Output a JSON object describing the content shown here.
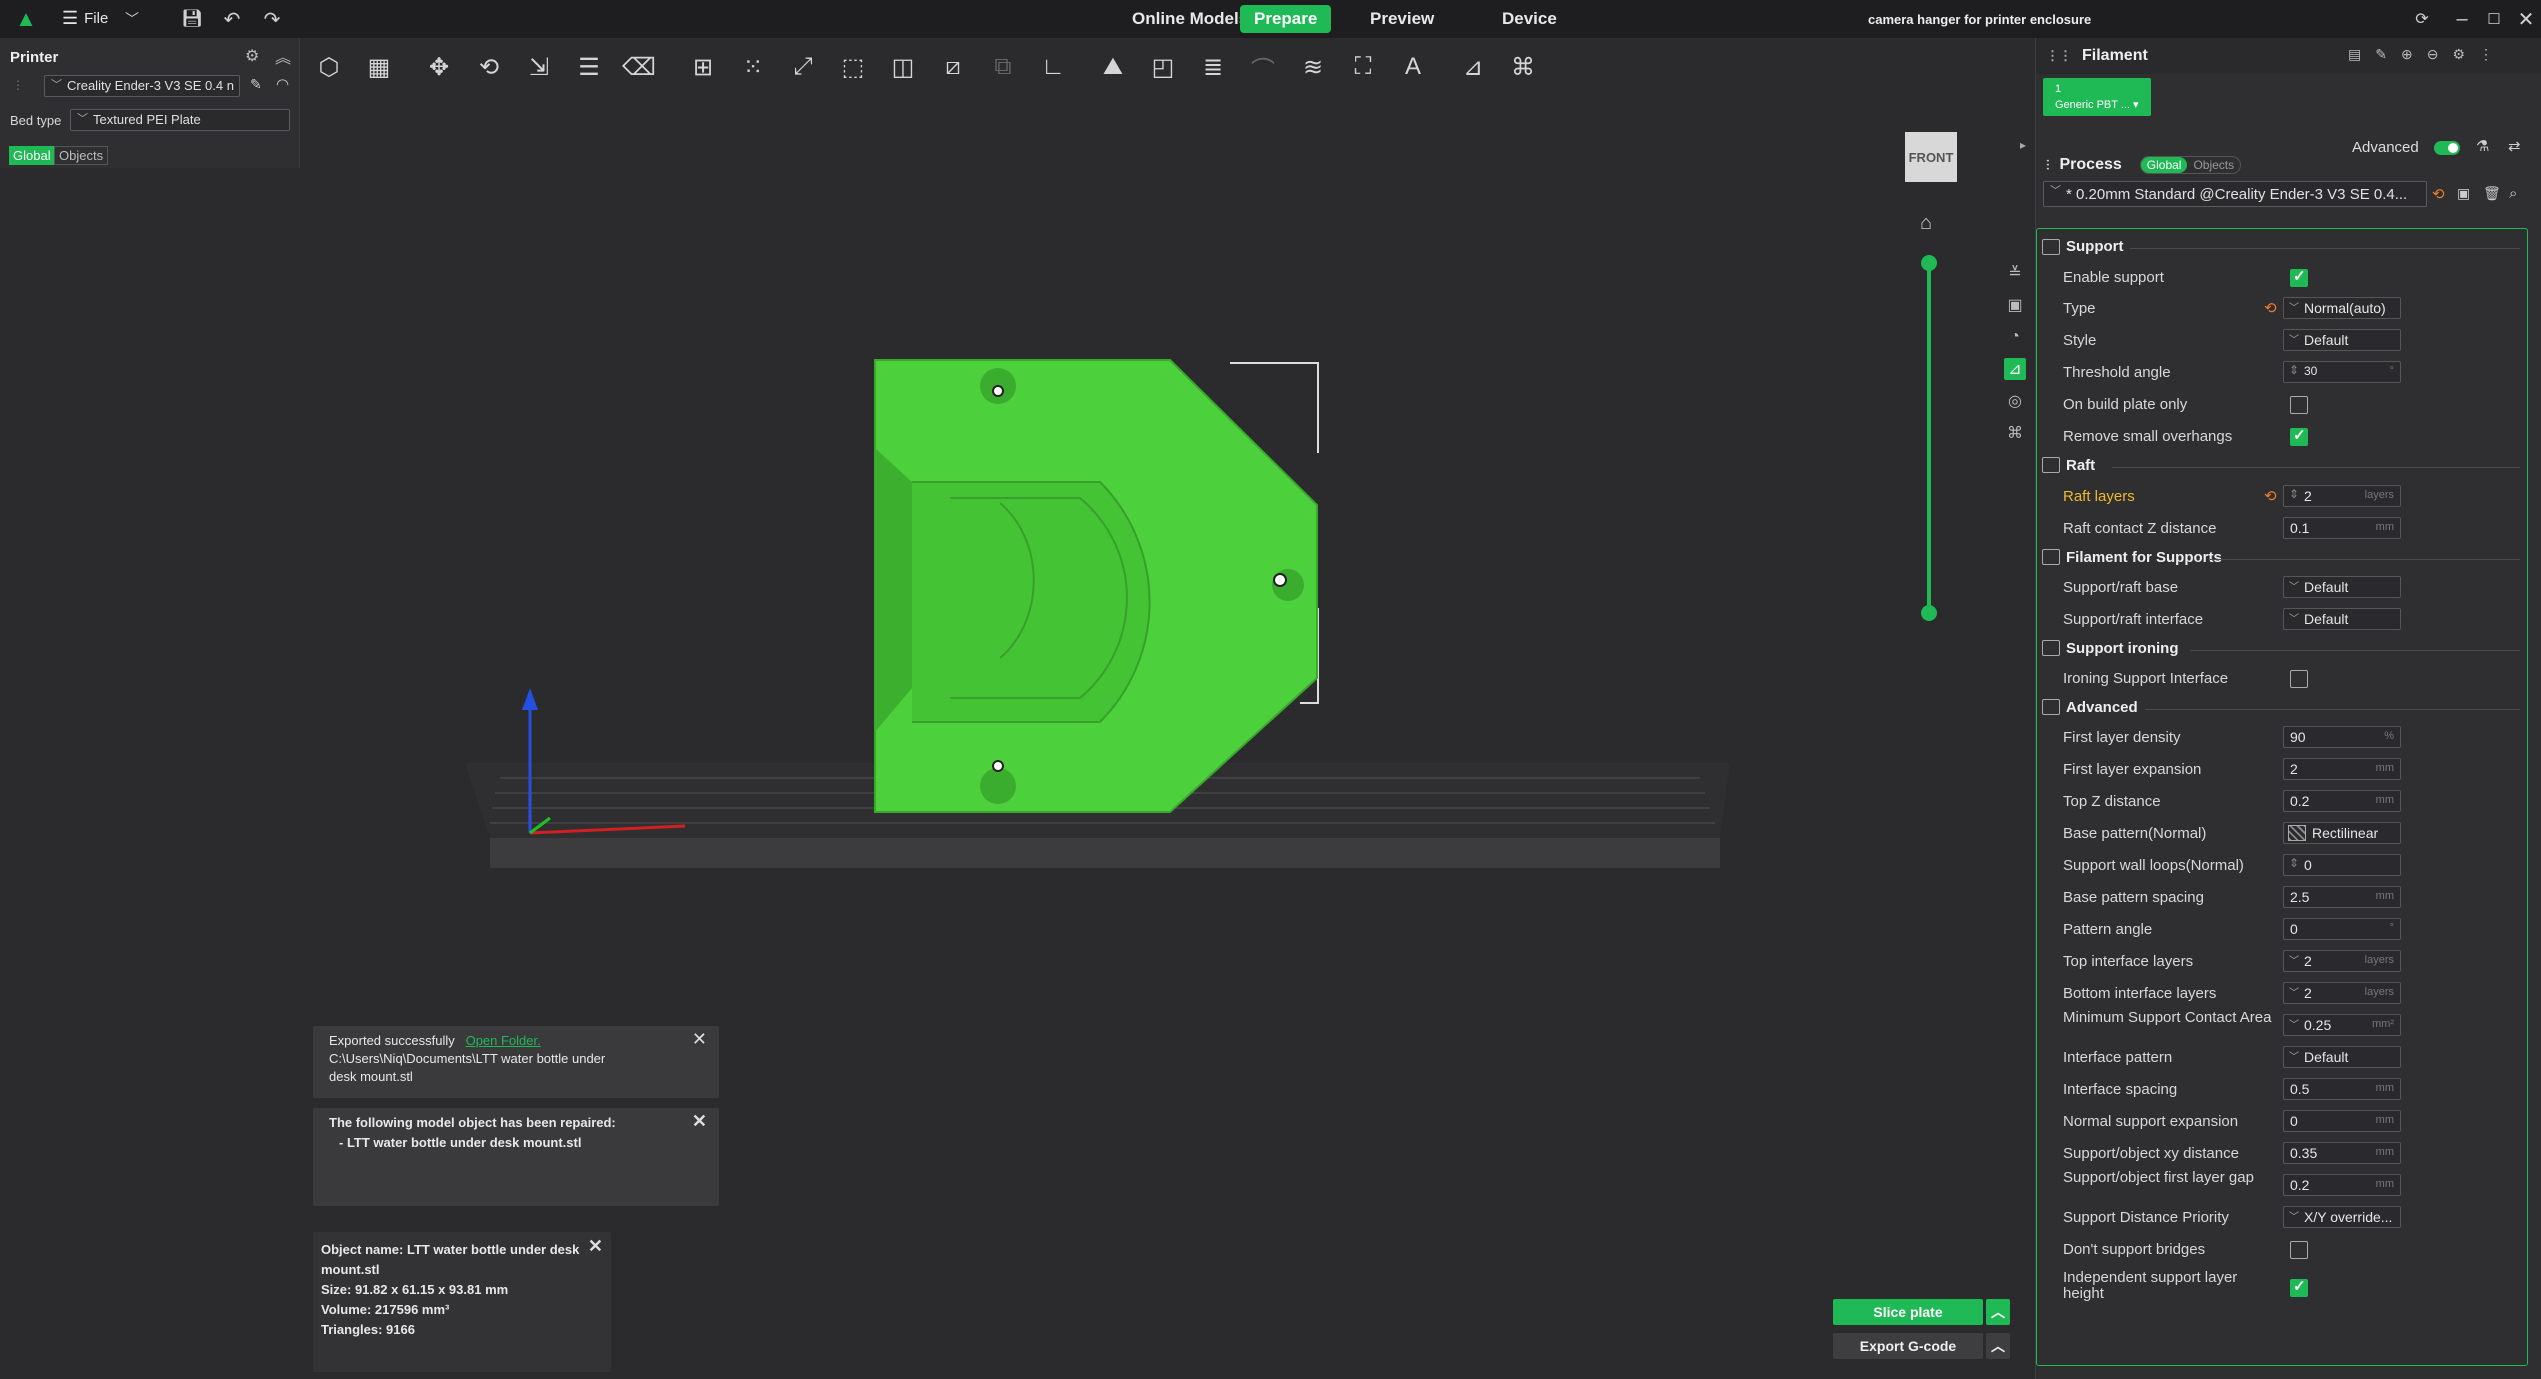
{
  "titlebar": {
    "file_label": "File",
    "tabs": [
      "Online Models",
      "Prepare",
      "Preview",
      "Device"
    ],
    "active_tab": "Prepare",
    "window_title": "camera hanger for printer enclosure"
  },
  "left_panel": {
    "printer_title": "Printer",
    "printer_name": "Creality Ender-3 V3 SE 0.4 n",
    "bed_type_label": "Bed type",
    "bed_type_value": "Textured PEI Plate",
    "toggle_global": "Global",
    "toggle_objects": "Objects"
  },
  "viewport": {
    "view_cube_label": "FRONT"
  },
  "notifications": {
    "exported_text": "Exported successfully",
    "open_folder": "Open Folder.",
    "exported_path_line1": "C:\\Users\\Niq\\Documents\\LTT water bottle under",
    "exported_path_line2": "desk mount.stl",
    "repaired_title": "The following model object has been repaired:",
    "repaired_item": "- LTT water bottle under desk mount.stl"
  },
  "object_info": {
    "name_line1": "Object name: LTT water bottle under desk",
    "name_line2": "mount.stl",
    "size": "Size: 91.82 x 61.15 x 93.81 mm",
    "volume": "Volume: 217596 mm³",
    "triangles": "Triangles: 9166"
  },
  "buttons": {
    "slice": "Slice plate",
    "export": "Export G-code"
  },
  "right_panel": {
    "filament_title": "Filament",
    "filament_slot_number": "1",
    "filament_name": "Generic PBT ...",
    "process_title": "Process",
    "process_global": "Global",
    "process_objects": "Objects",
    "advanced_label": "Advanced",
    "profile_name": "* 0.20mm Standard @Creality Ender-3 V3 SE 0.4..."
  },
  "settings": {
    "support_section": "Support",
    "enable_support": "Enable support",
    "type_label": "Type",
    "type_value": "Normal(auto)",
    "style_label": "Style",
    "style_value": "Default",
    "threshold_label": "Threshold angle",
    "threshold_value": "30",
    "threshold_unit": "°",
    "build_plate_only": "On build plate only",
    "remove_small": "Remove small overhangs",
    "raft_section": "Raft",
    "raft_layers_label": "Raft layers",
    "raft_layers_value": "2",
    "raft_z_label": "Raft contact Z distance",
    "raft_z_value": "0.1",
    "filament_supports_section": "Filament for Supports",
    "base_filament_label": "Support/raft base",
    "base_filament_value": "Default",
    "interface_filament_label": "Support/raft interface",
    "interface_filament_value": "Default",
    "ironing_section": "Support ironing",
    "ironing_interface": "Ironing Support Interface",
    "advanced_section": "Advanced",
    "first_layer_density_label": "First layer density",
    "first_layer_density_value": "90",
    "first_layer_expansion_label": "First layer expansion",
    "first_layer_expansion_value": "2",
    "top_z_label": "Top Z distance",
    "top_z_value": "0.2",
    "base_pattern_label": "Base pattern(Normal)",
    "base_pattern_value": "Rectilinear",
    "wall_loops_label": "Support wall loops(Normal)",
    "wall_loops_value": "0",
    "base_spacing_label": "Base pattern spacing",
    "base_spacing_value": "2.5",
    "pattern_angle_label": "Pattern angle",
    "pattern_angle_value": "0",
    "top_interface_label": "Top interface layers",
    "top_interface_value": "2",
    "bottom_interface_label": "Bottom interface layers",
    "bottom_interface_value": "2",
    "min_contact_label": "Minimum Support Contact Area",
    "min_contact_value": "0.25",
    "interface_pattern_label": "Interface pattern",
    "interface_pattern_value": "Default",
    "interface_spacing_label": "Interface spacing",
    "interface_spacing_value": "0.5",
    "normal_expansion_label": "Normal support expansion",
    "normal_expansion_value": "0",
    "xy_distance_label": "Support/object xy distance",
    "xy_distance_value": "0.35",
    "first_layer_gap_label": "Support/object first layer gap",
    "first_layer_gap_value": "0.2",
    "distance_priority_label": "Support Distance Priority",
    "distance_priority_value": "X/Y override...",
    "dont_support_bridges": "Don't support bridges",
    "independent_layer_height": "Independent support layer height",
    "unit_mm": "mm",
    "unit_layers": "layers",
    "unit_percent": "%",
    "unit_mm2": "mm²"
  },
  "colors": {
    "accent": "#1fb955",
    "model": "#4cd13c",
    "modified": "#f0b82a"
  }
}
